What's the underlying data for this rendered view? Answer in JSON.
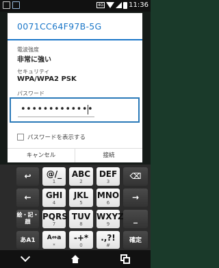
{
  "status_bar": {
    "time": "11:36",
    "badge": "4G"
  },
  "dialog": {
    "title": "0071CC64F97B-5G",
    "signal_strength_label": "電波強度",
    "signal_strength_value": "非常に強い",
    "security_label": "セキュリティ",
    "security_value": "WPA/WPA2 PSK",
    "password_label": "パスワード",
    "password_value": "•••••••••••••",
    "show_password_label": "パスワードを表示する",
    "show_password_checked": false,
    "cancel_label": "キャンセル",
    "connect_label": "接続"
  },
  "keyboard": {
    "rows": [
      [
        "↩",
        "@/_",
        "ABC",
        "DEF",
        "⌫"
      ],
      [
        "←",
        "GHI",
        "JKL",
        "MNO",
        "→"
      ],
      [
        "絵・記・顔",
        "PQRS",
        "TUV",
        "WXYZ",
        "_"
      ],
      [
        "あA1",
        "A⇔a",
        "-+*",
        ".,?!",
        "確定"
      ]
    ],
    "subs": {
      "k12": "1",
      "k13": "2",
      "k14": "3",
      "k22": "4",
      "k23": "5",
      "k24": "6",
      "k32": "7",
      "k33": "8",
      "k34": "9",
      "k42": "*",
      "k43": "0",
      "k44": "#"
    }
  },
  "nav_bar": {
    "icons": [
      "back-icon",
      "home-icon",
      "recent-apps-icon"
    ]
  }
}
